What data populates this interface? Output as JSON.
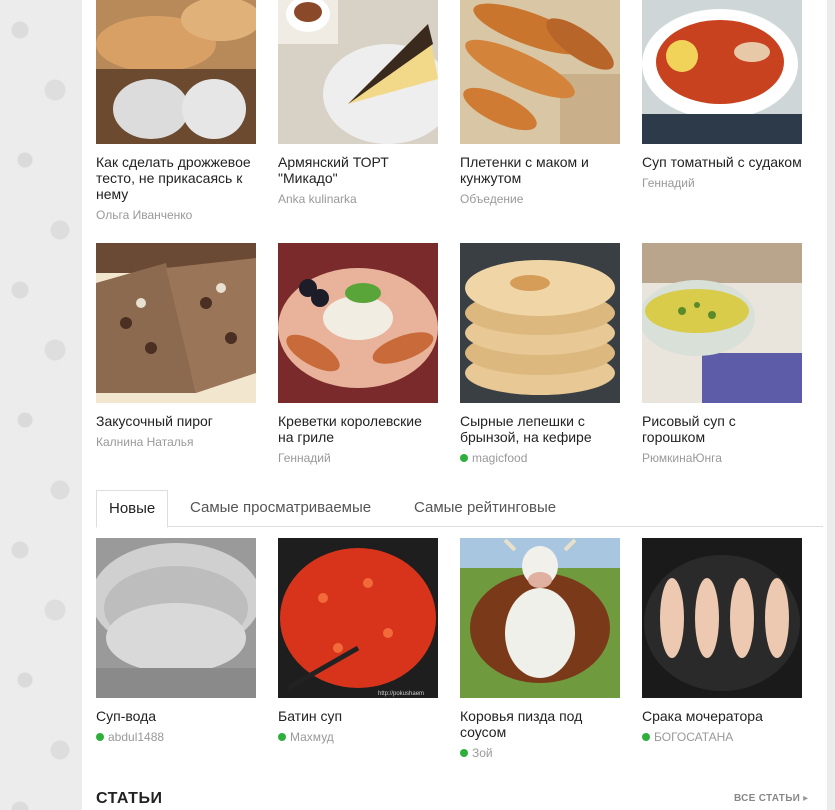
{
  "row1": [
    {
      "title": "Как сделать дрожжевое тесто, не прикасаясь к нему",
      "author": "Ольга Иванченко",
      "online": false,
      "image": "dough-photo"
    },
    {
      "title": "Армянский ТОРТ \"Микадо\"",
      "author": "Anka kulinarka",
      "online": false,
      "image": "cake-photo"
    },
    {
      "title": "Плетенки с маком и кунжутом",
      "author": "Объедение",
      "online": false,
      "image": "braided-buns-photo"
    },
    {
      "title": "Суп томатный с судаком",
      "author": "Геннадий",
      "online": false,
      "image": "tomato-soup-photo"
    }
  ],
  "row2": [
    {
      "title": "Закусочный пирог",
      "author": "Калнина Наталья",
      "online": false,
      "image": "snack-pie-photo"
    },
    {
      "title": "Креветки королевские на гриле",
      "author": "Геннадий",
      "online": false,
      "image": "grilled-shrimp-photo"
    },
    {
      "title": "Сырные лепешки с брынзой, на кефире",
      "author": "magicfood",
      "online": true,
      "image": "cheese-flatbread-photo"
    },
    {
      "title": "Рисовый суп с горошком",
      "author": "РюмкинаЮнга",
      "online": false,
      "image": "rice-soup-photo"
    }
  ],
  "tabs": [
    {
      "label": "Новые",
      "active": true
    },
    {
      "label": "Самые просматриваемые",
      "active": false
    },
    {
      "label": "Самые рейтинговые",
      "active": false
    }
  ],
  "row3": [
    {
      "title": "Суп-вода",
      "author": "abdul1488",
      "online": true,
      "image": "pot-of-water-photo"
    },
    {
      "title": "Батин суп",
      "author": "Махмуд",
      "online": true,
      "image": "red-stew-photo",
      "watermark": "http://pokushaem"
    },
    {
      "title": "Коровья пизда под соусом",
      "author": "Зой",
      "online": true,
      "image": "cow-photo"
    },
    {
      "title": "Срака мочератора",
      "author": "БОГОСАТАНА",
      "online": true,
      "image": "chicken-in-pan-photo"
    }
  ],
  "articles": {
    "title": "СТАТЬИ",
    "all_link": "ВСЕ СТАТЬИ"
  },
  "colors": {
    "online_dot": "#2eaf3c",
    "author_text": "#999999",
    "title_text": "#222222"
  }
}
